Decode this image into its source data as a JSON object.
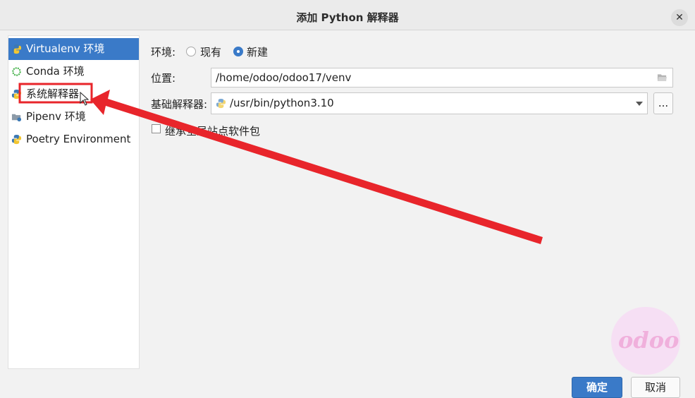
{
  "window": {
    "title": "添加 Python 解释器",
    "close_icon": "close-icon"
  },
  "sidebar": {
    "items": [
      {
        "label": "Virtualenv 环境",
        "icon": "python-virtualenv-icon",
        "selected": true
      },
      {
        "label": "Conda 环境",
        "icon": "conda-ring-icon",
        "selected": false
      },
      {
        "label": "系统解释器",
        "icon": "python-icon",
        "selected": false
      },
      {
        "label": "Pipenv 环境",
        "icon": "pipenv-folder-icon",
        "selected": false
      },
      {
        "label": "Poetry Environment",
        "icon": "poetry-icon",
        "selected": false
      }
    ]
  },
  "form": {
    "env_label": "环境:",
    "env_options": [
      {
        "label": "现有",
        "selected": false
      },
      {
        "label": "新建",
        "selected": true
      }
    ],
    "location_label": "位置:",
    "location_value": "/home/odoo/odoo17/venv",
    "base_label": "基础解释器:",
    "base_value": "/usr/bin/python3.10",
    "browse_label": "...",
    "inherit_label": "继承全局站点软件包",
    "inherit_checked": false
  },
  "buttons": {
    "ok": "确定",
    "cancel": "取消"
  },
  "annotation": {
    "color": "#e8252b"
  },
  "watermark": {
    "text": "odoo"
  }
}
